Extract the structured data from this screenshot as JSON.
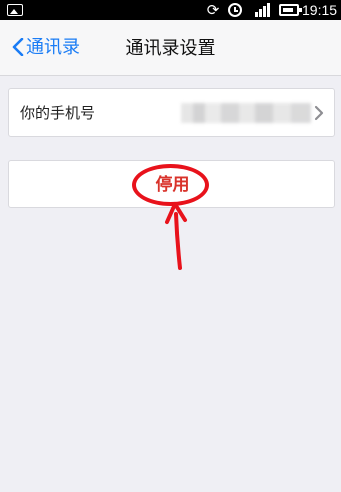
{
  "status_bar": {
    "time": "19:15",
    "icons": [
      "image-icon",
      "sync-icon",
      "alarm-icon",
      "signal-icon",
      "battery-icon"
    ]
  },
  "nav": {
    "back_label": "通讯录",
    "title": "通讯录设置"
  },
  "phone_row": {
    "label": "你的手机号"
  },
  "disable_button": {
    "label": "停用"
  },
  "colors": {
    "accent": "#1a7cf5",
    "danger_text": "#d9332b",
    "annotation": "#e8121b",
    "background": "#efeff4"
  }
}
